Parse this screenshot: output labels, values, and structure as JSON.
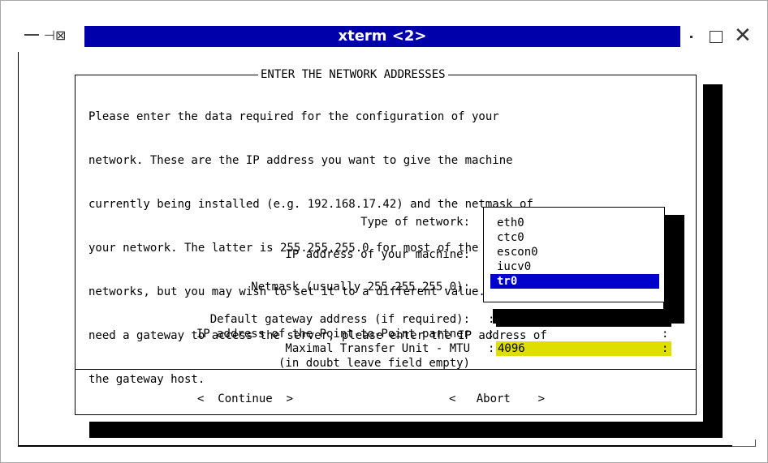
{
  "window": {
    "title": "xterm <2>"
  },
  "dialog": {
    "title": "ENTER THE NETWORK ADDRESSES",
    "description_lines": [
      "Please enter the data required for the configuration of your",
      "network. These are the IP address you want to give the machine",
      "currently being installed (e.g. 192.168.17.42) and the netmask of",
      "your network. The latter is 255.255.255.0 for most of the (smaller)",
      "networks, but you may wish to set it to a different value. If you",
      "need a gateway to access the server, please enter the IP address of",
      "the gateway host."
    ],
    "labels": {
      "network_type": "Type of network:",
      "ip_address": "IP address of your machine:",
      "netmask": "Netmask (usually 255.255.255.0):",
      "gateway": "Default gateway address (if required):",
      "ptp_partner": "IP address of the Point-to-Point partner",
      "mtu": "Maximal Transfer Unit - MTU",
      "mtu_hint": "(in doubt leave field empty)"
    },
    "network_options": [
      "eth0",
      "ctc0",
      "escon0",
      "iucv0",
      "tr0"
    ],
    "selected_network": "tr0",
    "fields": {
      "gateway_value": "",
      "ptp_value": "",
      "mtu_value": "4096"
    },
    "buttons": {
      "continue": "<  Continue  >",
      "abort": "<   Abort    >"
    }
  },
  "colors": {
    "title_bar": "#0000aa",
    "selection": "#0000cc",
    "active_field": "#dede00"
  }
}
